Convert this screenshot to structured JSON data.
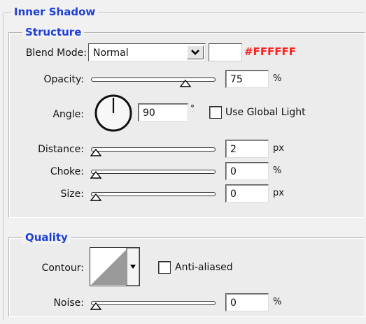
{
  "inner_shadow": {
    "title": "Inner Shadow",
    "structure": {
      "title": "Structure",
      "blend_mode_label": "Blend Mode:",
      "blend_mode_value": "Normal",
      "color_hex": "#FFFFFF",
      "color_swatch": "#ffffff",
      "color_label_color": "#ff2020",
      "opacity_label": "Opacity:",
      "opacity_value": "75",
      "opacity_unit": "%",
      "opacity_level": 0.75,
      "angle_label": "Angle:",
      "angle_value": "90",
      "angle_unit": "°",
      "use_global_light_label": "Use Global Light",
      "use_global_light_checked": false,
      "distance_label": "Distance:",
      "distance_value": "2",
      "distance_unit": "px",
      "distance_level": 0.0,
      "choke_label": "Choke:",
      "choke_value": "0",
      "choke_unit": "%",
      "choke_level": 0.0,
      "size_label": "Size:",
      "size_value": "0",
      "size_unit": "px",
      "size_level": 0.0
    },
    "quality": {
      "title": "Quality",
      "contour_label": "Contour:",
      "anti_aliased_label": "Anti-aliased",
      "anti_aliased_checked": false,
      "noise_label": "Noise:",
      "noise_value": "0",
      "noise_unit": "%",
      "noise_level": 0.0
    }
  }
}
